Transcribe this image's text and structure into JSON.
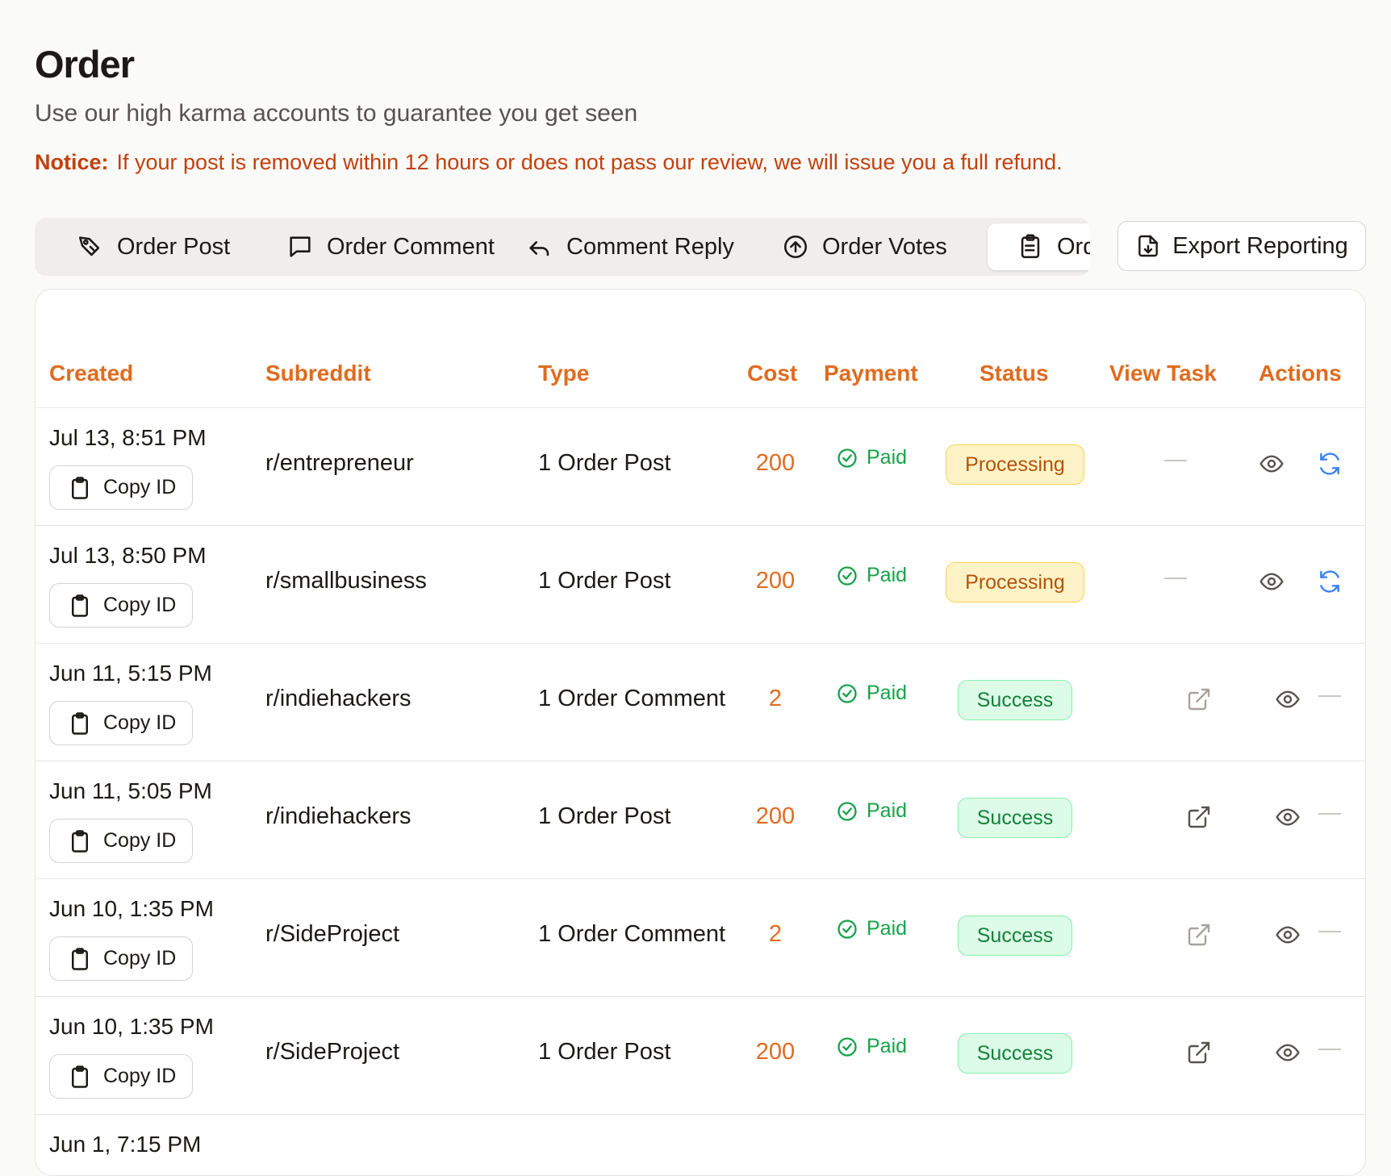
{
  "page": {
    "title": "Order",
    "subtitle": "Use our high karma accounts to guarantee you get seen",
    "notice_label": "Notice:",
    "notice_text": "If your post is removed within 12 hours or does not pass our review, we will issue you a full refund."
  },
  "tabs": [
    {
      "label": "Order Post",
      "icon": "tag-pen-icon"
    },
    {
      "label": "Order Comment",
      "icon": "comment-icon"
    },
    {
      "label": "Comment Reply",
      "icon": "reply-icon"
    },
    {
      "label": "Order Votes",
      "icon": "arrow-up-circle-icon"
    },
    {
      "label": "Ord",
      "icon": "clipboard-list-icon",
      "active": true
    }
  ],
  "export_button": {
    "label": "Export Reporting",
    "icon": "file-download-icon"
  },
  "table": {
    "columns": [
      "Created",
      "Subreddit",
      "Type",
      "Cost",
      "Payment",
      "Status",
      "View Task",
      "Actions"
    ],
    "copy_label": "Copy ID",
    "rows": [
      {
        "created": "Jul 13, 8:51 PM",
        "subreddit": "r/entrepreneur",
        "type": "1 Order Post",
        "cost": "200",
        "payment": "Paid",
        "status": "Processing",
        "view_task": "—",
        "actions": [
          "eye-icon",
          "refresh-icon"
        ]
      },
      {
        "created": "Jul 13, 8:50 PM",
        "subreddit": "r/smallbusiness",
        "type": "1 Order Post",
        "cost": "200",
        "payment": "Paid",
        "status": "Processing",
        "view_task": "—",
        "actions": [
          "eye-icon",
          "refresh-icon"
        ]
      },
      {
        "created": "Jun 11, 5:15 PM",
        "subreddit": "r/indiehackers",
        "type": "1 Order Comment",
        "cost": "2",
        "payment": "Paid",
        "status": "Success",
        "view_task": "external-link-icon",
        "actions": [
          "eye-icon",
          "—"
        ]
      },
      {
        "created": "Jun 11, 5:05 PM",
        "subreddit": "r/indiehackers",
        "type": "1 Order Post",
        "cost": "200",
        "payment": "Paid",
        "status": "Success",
        "view_task": "external-link-icon",
        "actions": [
          "eye-icon",
          "—"
        ]
      },
      {
        "created": "Jun 10, 1:35 PM",
        "subreddit": "r/SideProject",
        "type": "1 Order Comment",
        "cost": "2",
        "payment": "Paid",
        "status": "Success",
        "view_task": "external-link-icon",
        "actions": [
          "eye-icon",
          "—"
        ]
      },
      {
        "created": "Jun 10, 1:35 PM",
        "subreddit": "r/SideProject",
        "type": "1 Order Post",
        "cost": "200",
        "payment": "Paid",
        "status": "Success",
        "view_task": "external-link-icon",
        "actions": [
          "eye-icon",
          "—"
        ]
      },
      {
        "created": "Jun 1, 7:15 PM",
        "partial": true
      }
    ]
  },
  "colors": {
    "accent": "#e06b1f",
    "notice": "#c2410c",
    "paid": "#16a34a",
    "processing_bg": "#fef3c7",
    "success_bg": "#dcfce7",
    "refresh": "#3b82f6"
  }
}
